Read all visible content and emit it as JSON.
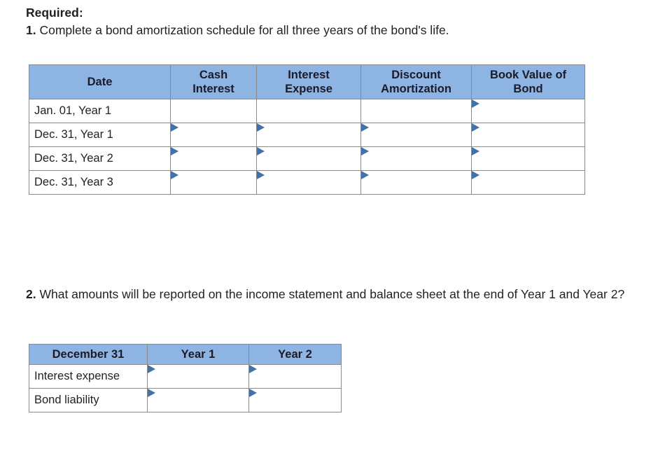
{
  "prompts": {
    "required_label": "Required:",
    "q1_number": "1.",
    "q1_text": " Complete a bond amortization schedule for all three years of the bond's life.",
    "q2_number": "2.",
    "q2_text": " What amounts will be reported on the income statement and balance sheet at the end of Year 1 and Year 2?"
  },
  "colors": {
    "header_blue": "#8db4e2",
    "marker_blue": "#4472a8",
    "border_gray": "#8a8a8a",
    "text": "#231f20",
    "background": "#ffffff"
  },
  "schedule_table": {
    "headers": {
      "date": "Date",
      "cash_interest": "Cash\nInterest",
      "cash_interest_line1": "Cash",
      "cash_interest_line2": "Interest",
      "interest_expense_line1": "Interest",
      "interest_expense_line2": "Expense",
      "discount_amortization_line1": "Discount",
      "discount_amortization_line2": "Amortization",
      "book_value_line1": "Book Value of",
      "book_value_line2": "Bond"
    },
    "rows": [
      {
        "date": "Jan. 01, Year 1",
        "cash_interest": "",
        "interest_expense": "",
        "discount_amortization": "",
        "book_value": "",
        "markers": {
          "cash_interest": false,
          "interest_expense": false,
          "discount_amortization": false,
          "book_value": true
        }
      },
      {
        "date": "Dec. 31, Year 1",
        "cash_interest": "",
        "interest_expense": "",
        "discount_amortization": "",
        "book_value": "",
        "markers": {
          "cash_interest": true,
          "interest_expense": true,
          "discount_amortization": true,
          "book_value": true
        }
      },
      {
        "date": "Dec. 31, Year 2",
        "cash_interest": "",
        "interest_expense": "",
        "discount_amortization": "",
        "book_value": "",
        "markers": {
          "cash_interest": true,
          "interest_expense": true,
          "discount_amortization": true,
          "book_value": true
        }
      },
      {
        "date": "Dec. 31, Year 3",
        "cash_interest": "",
        "interest_expense": "",
        "discount_amortization": "",
        "book_value": "",
        "markers": {
          "cash_interest": true,
          "interest_expense": true,
          "discount_amortization": true,
          "book_value": true
        }
      }
    ]
  },
  "amounts_table": {
    "headers": {
      "label": "December 31",
      "year1": "Year 1",
      "year2": "Year 2"
    },
    "rows": [
      {
        "label": "Interest expense",
        "year1": "",
        "year2": "",
        "markers": {
          "year1": true,
          "year2": true
        }
      },
      {
        "label": "Bond liability",
        "year1": "",
        "year2": "",
        "markers": {
          "year1": true,
          "year2": true
        }
      }
    ]
  },
  "icons": {
    "cell_marker": "blue-triangle-marker-icon"
  }
}
